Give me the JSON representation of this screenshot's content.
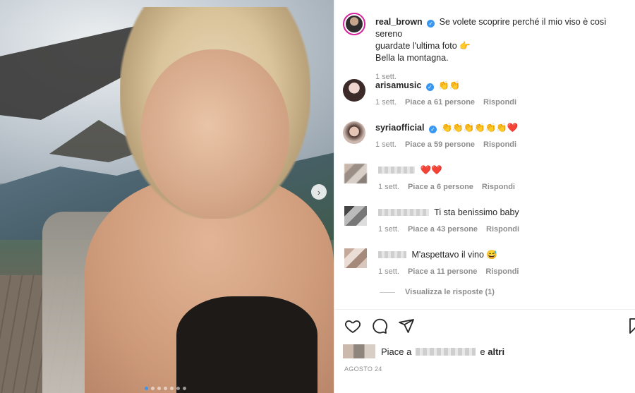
{
  "post": {
    "username": "real_brown",
    "caption": "Se volete scoprire perché il mio viso è così sereno",
    "caption2": "guardate l'ultima foto 👉",
    "caption3": "Bella la montagna.",
    "time": "1 sett."
  },
  "comments": [
    {
      "username": "arisamusic",
      "text": "👏👏",
      "time": "1 sett.",
      "likes": "Piace a 61 persone",
      "reply": "Rispondi"
    },
    {
      "username": "syriaofficial",
      "text": "👏👏👏👏👏👏❤️",
      "time": "1 sett.",
      "likes": "Piace a 59 persone",
      "reply": "Rispondi"
    },
    {
      "username": "",
      "text": "❤️❤️",
      "time": "1 sett.",
      "likes": "Piace a 6 persone",
      "reply": "Rispondi"
    },
    {
      "username": "",
      "text": "Ti sta benissimo baby",
      "time": "1 sett.",
      "likes": "Piace a 43 persone",
      "reply": "Rispondi"
    },
    {
      "username": "",
      "text": "M'aspettavo il vino 😅",
      "time": "1 sett.",
      "likes": "Piace a 11 persone",
      "reply": "Rispondi"
    }
  ],
  "view_replies": "Visualizza le risposte (1)",
  "likes_line": {
    "prefix": "Piace a",
    "suffix": "e",
    "others": "altri"
  },
  "date": "AGOSTO 24",
  "icons": [
    "heart-icon",
    "comment-icon",
    "share-icon",
    "bookmark-icon",
    "verified-icon",
    "chevron-right-icon"
  ],
  "colors": {
    "verified": "#3897f0",
    "secondary_text": "#8e8e8e",
    "story_ring": "#d6249f"
  }
}
